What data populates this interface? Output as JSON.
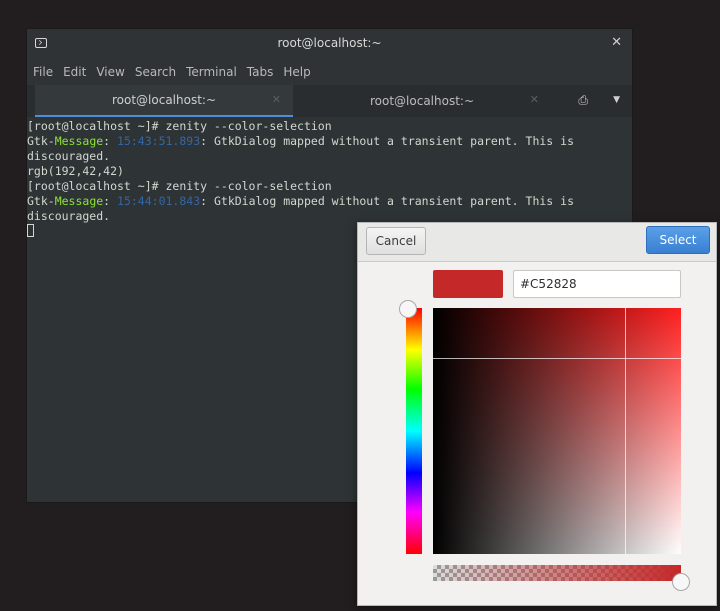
{
  "terminal": {
    "title": "root@localhost:~",
    "menu": [
      "File",
      "Edit",
      "View",
      "Search",
      "Terminal",
      "Tabs",
      "Help"
    ],
    "tabs": [
      {
        "label": "root@localhost:~"
      },
      {
        "label": "root@localhost:~"
      }
    ],
    "lines": {
      "l1": "[root@localhost ~]# zenity --color-selection",
      "l2_gtk": "Gtk-",
      "l2_msg": "Message",
      "l2_colon": ": ",
      "l2_time": "15:43:51.893",
      "l2_rest": ": GtkDialog mapped without a transient parent. This is",
      "l3": "discouraged.",
      "l4": "rgb(192,42,42)",
      "l5": "[root@localhost ~]# zenity --color-selection",
      "l6_gtk": "Gtk-",
      "l6_msg": "Message",
      "l6_colon": ": ",
      "l6_time": "15:44:01.843",
      "l6_rest": ": GtkDialog mapped without a transient parent. This is",
      "l7": "discouraged."
    }
  },
  "color_dialog": {
    "cancel_label": "Cancel",
    "select_label": "Select",
    "hex_value": "#C52828",
    "current_color": "#C52828",
    "hue_fraction": 0.0,
    "alpha_fraction": 1.0
  },
  "colors": {
    "accent_blue": "#4a90d9",
    "message_green": "#8ae234",
    "timestamp_blue": "#3465a4"
  }
}
